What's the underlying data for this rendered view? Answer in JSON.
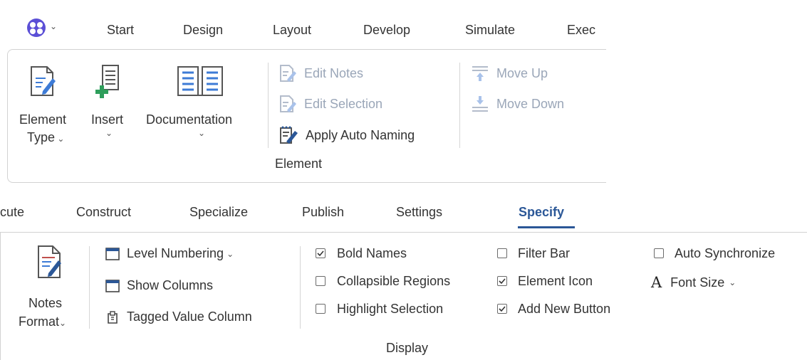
{
  "top": {
    "tabs": [
      "Start",
      "Design",
      "Layout",
      "Develop",
      "Simulate",
      "Exec"
    ],
    "large_buttons": {
      "element_type": [
        "Element",
        "Type"
      ],
      "insert": "Insert",
      "documentation": "Documentation"
    },
    "element_group": {
      "edit_notes": "Edit Notes",
      "edit_selection": "Edit Selection",
      "apply_auto_naming": "Apply Auto Naming",
      "group_label": "Element"
    },
    "move": {
      "move_up": "Move Up",
      "move_down": "Move Down"
    }
  },
  "bottom": {
    "tabs": [
      "cute",
      "Construct",
      "Specialize",
      "Publish",
      "Settings",
      "Specify"
    ],
    "active_tab": "Specify",
    "notes_format": [
      "Notes",
      "Format"
    ],
    "options": {
      "level_numbering": "Level Numbering",
      "show_columns": "Show Columns",
      "tagged_value_column": "Tagged Value Column"
    },
    "display": {
      "bold_names": {
        "label": "Bold Names",
        "checked": true
      },
      "collapsible_regions": {
        "label": "Collapsible Regions",
        "checked": false
      },
      "highlight_selection": {
        "label": "Highlight Selection",
        "checked": false
      },
      "filter_bar": {
        "label": "Filter Bar",
        "checked": false
      },
      "element_icon": {
        "label": "Element Icon",
        "checked": true
      },
      "add_new_button": {
        "label": "Add New Button",
        "checked": true
      },
      "auto_synchronize": {
        "label": "Auto Synchronize",
        "checked": false
      },
      "font_size": "Font Size",
      "group_label": "Display"
    }
  },
  "colors": {
    "accent": "#2b5797",
    "disabled": "#9aa6b8",
    "logo": "#5b4fd6"
  }
}
